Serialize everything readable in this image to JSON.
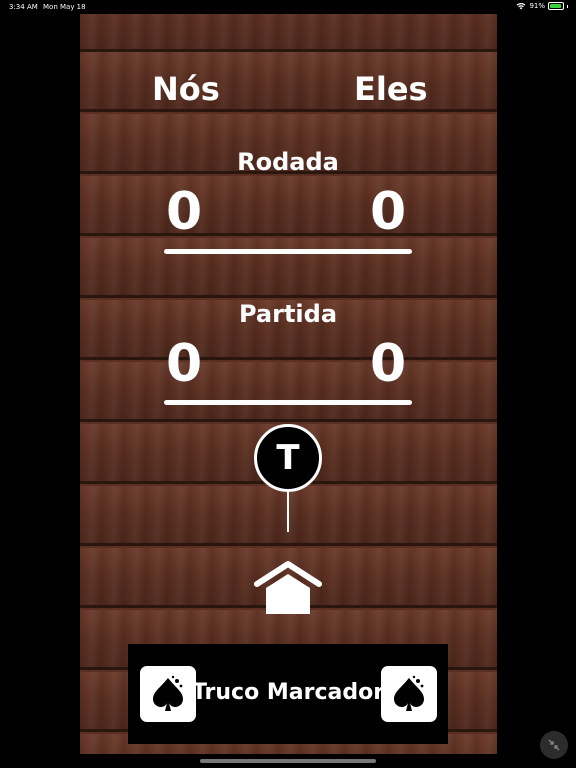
{
  "status_bar": {
    "time": "3:34 AM",
    "date": "Mon May 18",
    "battery_percent": "91%",
    "battery_level": 0.91,
    "battery_color": "#3ad13a"
  },
  "teams": {
    "left": "Nós",
    "right": "Eles"
  },
  "rodada": {
    "label": "Rodada",
    "left_score": "0",
    "right_score": "0"
  },
  "partida": {
    "label": "Partida",
    "left_score": "0",
    "right_score": "0"
  },
  "truco_button": {
    "label": "T"
  },
  "home_button": {
    "icon": "home-icon"
  },
  "banner": {
    "title": "Truco Marcador",
    "left_icon": "spade-card-icon",
    "right_icon": "spade-card-icon"
  },
  "colors": {
    "wood": "#5b3022",
    "wood_edge": "#2a150f",
    "text": "#ffffff",
    "banner_bg": "#000000"
  }
}
